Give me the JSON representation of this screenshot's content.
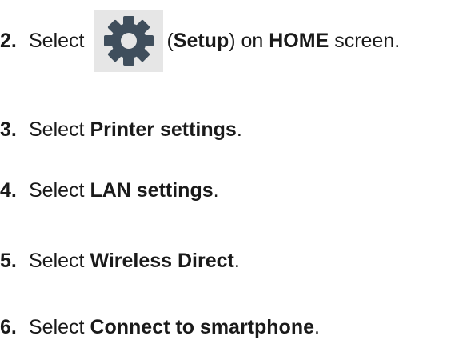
{
  "steps": [
    {
      "number": "2.",
      "prefix": "Select ",
      "icon": "setup-gear-icon",
      "paren_open": "(",
      "bold": "Setup",
      "paren_close": ")",
      "middle": " on ",
      "bold2": "HOME",
      "suffix": " screen."
    },
    {
      "number": "3.",
      "prefix": "Select ",
      "bold": "Printer settings",
      "suffix": "."
    },
    {
      "number": "4.",
      "prefix": "Select ",
      "bold": "LAN settings",
      "suffix": "."
    },
    {
      "number": "5.",
      "prefix": "Select ",
      "bold": "Wireless Direct",
      "suffix": "."
    },
    {
      "number": "6.",
      "prefix": "Select ",
      "bold": "Connect to smartphone",
      "suffix": "."
    }
  ],
  "colors": {
    "text": "#1a1a1a",
    "icon_gear": "#3f4e5c",
    "icon_background": "#e6e6e6"
  }
}
